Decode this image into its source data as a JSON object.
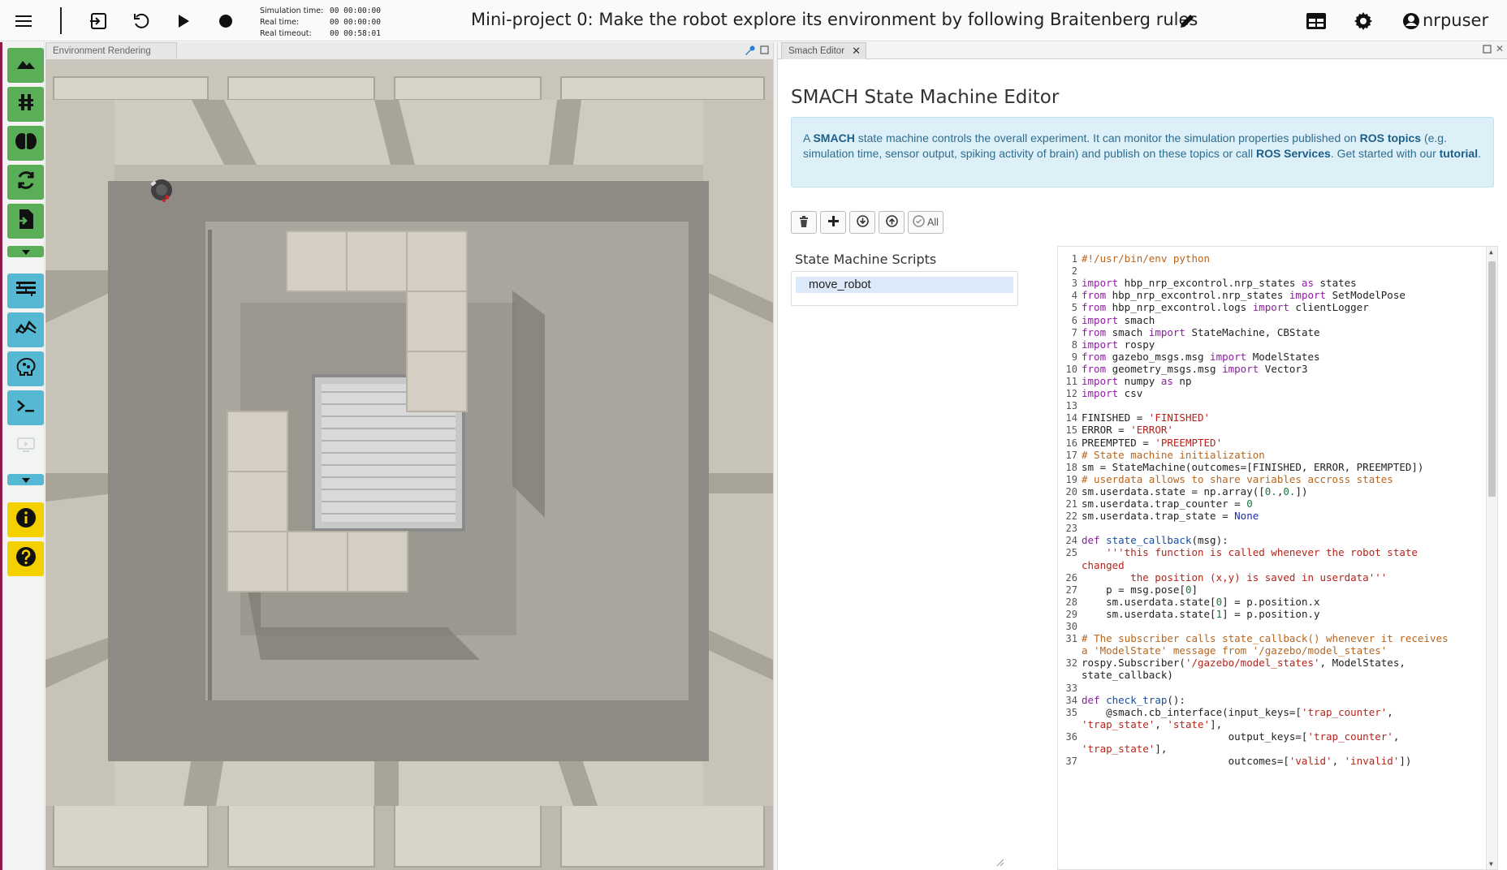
{
  "topbar": {
    "title": "Mini-project 0: Make the robot explore its environment by following Braitenberg rules",
    "user": "nrpuser",
    "sim_time_label": "Simulation time:",
    "sim_time_value": "00 00:00:00",
    "real_time_label": "Real time:",
    "real_time_value": "00 00:00:00",
    "timeout_label": "Real timeout:",
    "timeout_value": "00 00:58:01",
    "icons": [
      "menu-icon",
      "exit-icon",
      "reset-icon",
      "play-icon",
      "record-icon",
      "edit-icon",
      "layout-icon",
      "settings-icon",
      "account-icon"
    ]
  },
  "sidebar": {
    "buttons": [
      {
        "name": "environment-icon",
        "color": "#5aae58"
      },
      {
        "name": "object-library-icon",
        "color": "#5aae58"
      },
      {
        "name": "brain-icon",
        "color": "#5aae58"
      },
      {
        "name": "transfer-function-icon",
        "color": "#5aae58"
      },
      {
        "name": "state-machine-icon",
        "color": "#5aae58"
      },
      {
        "name": "spike-train-icon",
        "color": "#56b9d3"
      },
      {
        "name": "plot-icon",
        "color": "#56b9d3"
      },
      {
        "name": "brain-visualizer-icon",
        "color": "#56b9d3"
      },
      {
        "name": "terminal-icon",
        "color": "#56b9d3"
      },
      {
        "name": "info-icon",
        "color": "#f4d000"
      },
      {
        "name": "help-icon",
        "color": "#f4d000"
      }
    ]
  },
  "env_panel": {
    "tab_label": "Environment Rendering"
  },
  "smach": {
    "tab_label": "Smach Editor",
    "heading": "SMACH State Machine Editor",
    "info": {
      "t1": "A ",
      "b1": "SMACH",
      "t2": " state machine controls the overall experiment. It can monitor the simulation properties published on ",
      "b2": "ROS topics",
      "t3": " (e.g. simulation time, sensor output, spiking activity of brain) and publish on these topics or call ",
      "b3": "ROS Services",
      "t4": ". Get started with our ",
      "b4": "tutorial",
      "t5": "."
    },
    "toolbar": {
      "all_label": "All"
    },
    "scripts_title": "State Machine Scripts",
    "scripts": [
      "move_robot"
    ]
  },
  "code": {
    "lines": [
      {
        "n": "1",
        "y": 0,
        "html": "<span class=\"cm\">#!/usr/bin/env python</span>"
      },
      {
        "n": "2",
        "y": 1,
        "html": ""
      },
      {
        "n": "3",
        "y": 2,
        "html": "<span class=\"kw\">import</span> hbp_nrp_excontrol.nrp_states <span class=\"kw\">as</span> states"
      },
      {
        "n": "4",
        "y": 3,
        "html": "<span class=\"kw\">from</span> hbp_nrp_excontrol.nrp_states <span class=\"kw\">import</span> SetModelPose"
      },
      {
        "n": "5",
        "y": 4,
        "html": "<span class=\"kw\">from</span> hbp_nrp_excontrol.logs <span class=\"kw\">import</span> clientLogger"
      },
      {
        "n": "6",
        "y": 5,
        "html": "<span class=\"kw\">import</span> smach"
      },
      {
        "n": "7",
        "y": 6,
        "html": "<span class=\"kw\">from</span> smach <span class=\"kw\">import</span> StateMachine, CBState"
      },
      {
        "n": "8",
        "y": 7,
        "html": "<span class=\"kw\">import</span> rospy"
      },
      {
        "n": "9",
        "y": 8,
        "html": "<span class=\"kw\">from</span> gazebo_msgs.msg <span class=\"kw\">import</span> ModelStates"
      },
      {
        "n": "10",
        "y": 9,
        "html": "<span class=\"kw\">from</span> geometry_msgs.msg <span class=\"kw\">import</span> Vector3"
      },
      {
        "n": "11",
        "y": 10,
        "html": "<span class=\"kw\">import</span> numpy <span class=\"kw\">as</span> np"
      },
      {
        "n": "12",
        "y": 11,
        "html": "<span class=\"kw\">import</span> csv"
      },
      {
        "n": "13",
        "y": 12,
        "html": ""
      },
      {
        "n": "14",
        "y": 13,
        "html": "FINISHED = <span class=\"st\">'FINISHED'</span>"
      },
      {
        "n": "15",
        "y": 14,
        "html": "ERROR = <span class=\"st\">'ERROR'</span>"
      },
      {
        "n": "16",
        "y": 15,
        "html": "PREEMPTED = <span class=\"st\">'PREEMPTED'</span>"
      },
      {
        "n": "17",
        "y": 16,
        "html": "<span class=\"cm\"># State machine initialization</span>"
      },
      {
        "n": "18",
        "y": 17,
        "html": "sm = StateMachine(outcomes=[FINISHED, ERROR, PREEMPTED])"
      },
      {
        "n": "19",
        "y": 18,
        "html": "<span class=\"cm\"># userdata allows to share variables accross states</span>"
      },
      {
        "n": "20",
        "y": 19,
        "html": "sm.userdata.state = np.array([<span class=\"nu\">0.</span>,<span class=\"nu\">0.</span>])"
      },
      {
        "n": "21",
        "y": 20,
        "html": "sm.userdata.trap_counter = <span class=\"nu\">0</span>"
      },
      {
        "n": "22",
        "y": 21,
        "html": "sm.userdata.trap_state = <span class=\"bi\">None</span>"
      },
      {
        "n": "23",
        "y": 22,
        "html": ""
      },
      {
        "n": "24",
        "y": 23,
        "html": "<span class=\"kw\">def</span> <span class=\"fn\">state_callback</span>(msg):"
      },
      {
        "n": "25",
        "y": 24,
        "html": "    <span class=\"st\">'''this function is called whenever the robot state</span>"
      },
      {
        "n": "",
        "y": 25,
        "html": "<span class=\"st\">changed</span>"
      },
      {
        "n": "26",
        "y": 26,
        "html": "<span class=\"st\">        the position (x,y) is saved in userdata'''</span>"
      },
      {
        "n": "27",
        "y": 27,
        "html": "    p = msg.pose[<span class=\"nu\">0</span>]"
      },
      {
        "n": "28",
        "y": 28,
        "html": "    sm.userdata.state[<span class=\"nu\">0</span>] = p.position.x"
      },
      {
        "n": "29",
        "y": 29,
        "html": "    sm.userdata.state[<span class=\"nu\">1</span>] = p.position.y"
      },
      {
        "n": "30",
        "y": 30,
        "html": ""
      },
      {
        "n": "31",
        "y": 31,
        "html": "<span class=\"cm\"># The subscriber calls state_callback() whenever it receives</span>"
      },
      {
        "n": "",
        "y": 32,
        "html": "<span class=\"cm\">a 'ModelState' message from '/gazebo/model_states'</span>"
      },
      {
        "n": "32",
        "y": 33,
        "html": "rospy.Subscriber(<span class=\"st\">'/gazebo/model_states'</span>, ModelStates,"
      },
      {
        "n": "",
        "y": 34,
        "html": "state_callback)"
      },
      {
        "n": "33",
        "y": 35,
        "html": ""
      },
      {
        "n": "34",
        "y": 36,
        "html": "<span class=\"kw\">def</span> <span class=\"fn\">check_trap</span>():"
      },
      {
        "n": "35",
        "y": 37,
        "html": "    @smach.cb_interface(input_keys=[<span class=\"st\">'trap_counter'</span>,"
      },
      {
        "n": "",
        "y": 38,
        "html": "<span class=\"st\">'trap_state'</span>, <span class=\"st\">'state'</span>],"
      },
      {
        "n": "36",
        "y": 39,
        "html": "                        output_keys=[<span class=\"st\">'trap_counter'</span>,"
      },
      {
        "n": "",
        "y": 40,
        "html": "<span class=\"st\">'trap_state'</span>],"
      },
      {
        "n": "37",
        "y": 41,
        "html": "                        outcomes=[<span class=\"st\">'valid'</span>, <span class=\"st\">'invalid'</span>])"
      }
    ]
  }
}
